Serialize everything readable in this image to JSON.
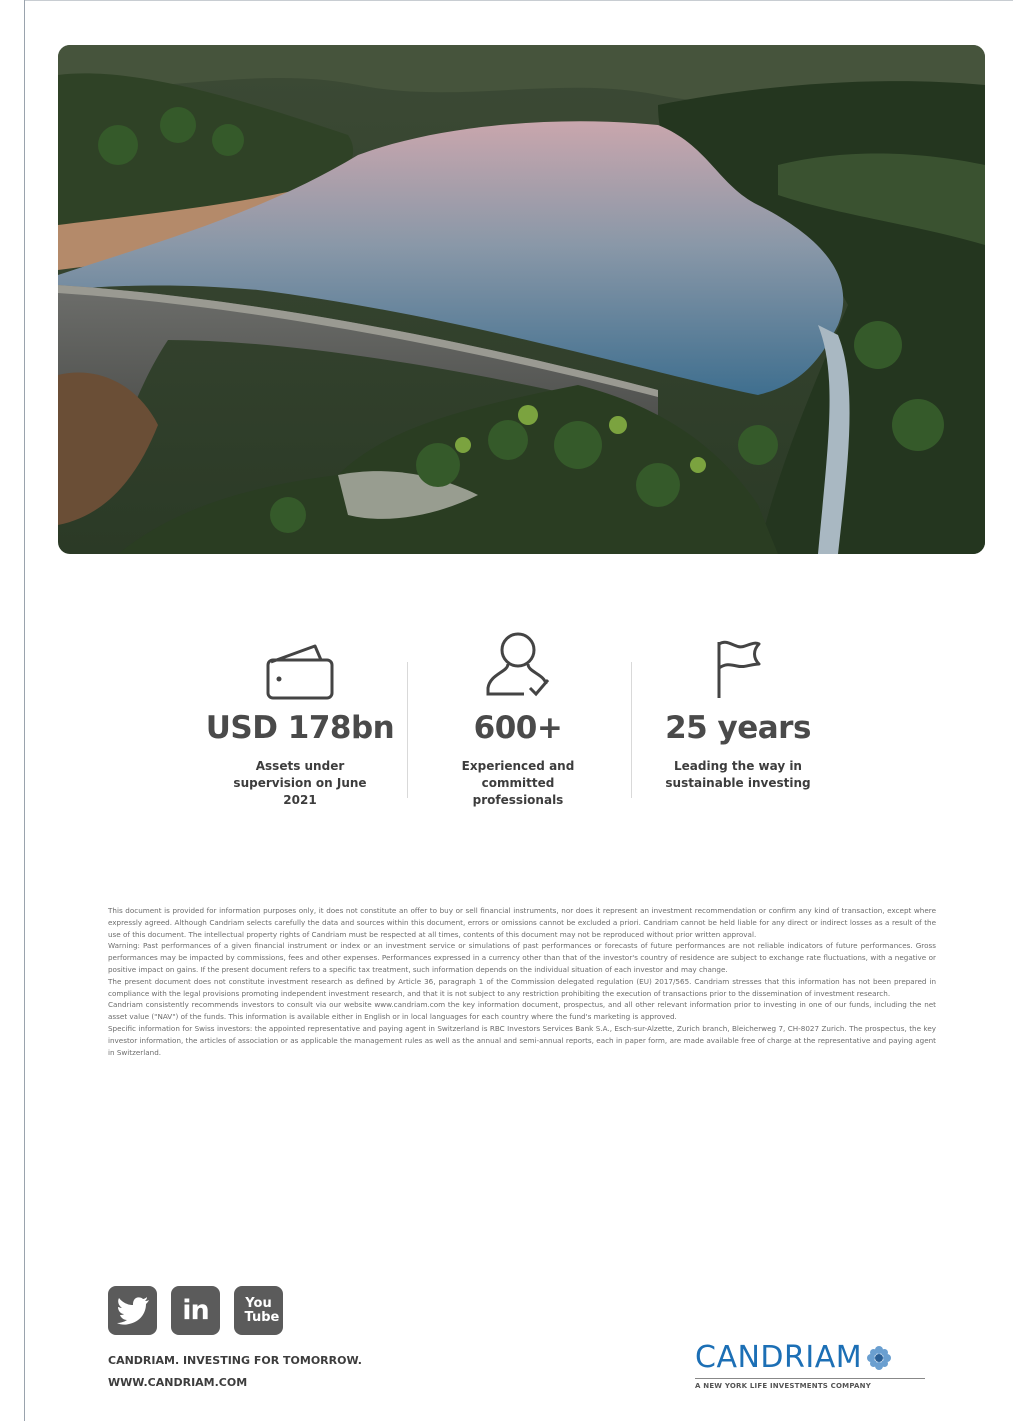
{
  "stats": [
    {
      "value": "USD 178bn",
      "desc": "Assets under supervision on June 2021",
      "icon": "wallet-icon"
    },
    {
      "value": "600+",
      "desc": "Experienced and committed professionals",
      "icon": "person-icon"
    },
    {
      "value": "25 years",
      "desc": "Leading the way in sustainable investing",
      "icon": "flag-icon"
    }
  ],
  "disclaimer": [
    "This document is provided for information purposes only, it does not constitute an offer to buy or sell financial instruments, nor does it represent an investment recommendation or confirm any kind of transaction, except where expressly agreed. Although Candriam selects carefully the data and sources within this document, errors or omissions cannot be excluded a priori. Candriam cannot be held liable for any direct or indirect losses as a result of the use of this document. The intellectual property rights of Candriam must be respected at all times, contents of this document may not be reproduced without prior written approval.",
    "Warning: Past performances of a given financial instrument or index or an investment service or simulations of past performances or forecasts of future performances are not reliable indicators of future performances. Gross performances may be impacted by commissions, fees and other expenses. Performances expressed in a currency other than that of the investor's country of residence are subject to exchange rate fluctuations, with a negative or positive impact on gains. If the present document refers to a specific tax treatment, such information depends on the individual situation of each investor and may change.",
    "The present document does not constitute investment research as defined by Article 36, paragraph 1 of the Commission delegated regulation (EU) 2017/565. Candriam stresses that this information has not been prepared in compliance with the legal provisions promoting independent investment research, and that it is not subject to any restriction prohibiting the execution of transactions prior to the dissemination of investment research.",
    "Candriam consistently recommends investors to consult via our website www.candriam.com the key information document, prospectus, and all other relevant information prior to investing in one of our funds, including the net asset value (\"NAV\") of the funds. This information is available either in English or in local languages for each country where the fund's marketing is approved.",
    "Specific information for Swiss investors: the appointed representative and paying agent in Switzerland is RBC Investors Services Bank S.A., Esch-sur-Alzette, Zurich branch, Bleicherweg 7, CH-8027 Zurich. The prospectus, the key investor information, the articles of association or as applicable the management rules as well as the annual and semi-annual reports, each in paper form, are made available free of charge at the representative and paying agent in Switzerland."
  ],
  "social": [
    {
      "icon": "twitter-icon",
      "label": ""
    },
    {
      "icon": "linkedin-icon",
      "label": "in"
    },
    {
      "icon": "youtube-icon",
      "label": "You Tube"
    }
  ],
  "footer": {
    "tagline": "CANDRIAM. INVESTING FOR TOMORROW.",
    "website": "WWW.CANDRIAM.COM",
    "brand": "CANDRIAM",
    "brand_sub": "A NEW YORK LIFE INVESTMENTS COMPANY"
  },
  "colors": {
    "brand_blue": "#1c6fb5",
    "icon_gray": "#5b5b5b"
  }
}
